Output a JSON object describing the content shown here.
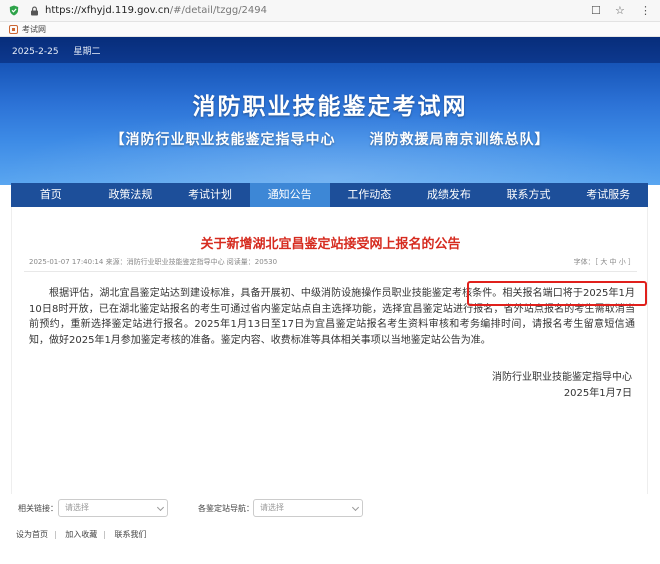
{
  "browser": {
    "url_main": "https://xfhyjd.119.gov.cn",
    "url_path": "/#/detail/tzgg/2494",
    "tab_title": "考试网",
    "tools": [
      "☐",
      "☆",
      "⋮"
    ]
  },
  "banner": {
    "date": "2025-2-25",
    "weekday": "星期二",
    "title": "消防职业技能鉴定考试网",
    "subtitle_left": "【消防行业职业技能鉴定指导中心",
    "subtitle_right": "消防救援局南京训练总队】"
  },
  "nav": {
    "items": [
      {
        "label": "首页"
      },
      {
        "label": "政策法规"
      },
      {
        "label": "考试计划"
      },
      {
        "label": "通知公告",
        "active": true
      },
      {
        "label": "工作动态"
      },
      {
        "label": "成绩发布"
      },
      {
        "label": "联系方式"
      },
      {
        "label": "考试服务"
      }
    ]
  },
  "article": {
    "title": "关于新增湖北宜昌鉴定站接受网上报名的公告",
    "meta": "2025-01-07 17:40:14  来源：消防行业职业技能鉴定指导中心  阅读量：20530",
    "font_size_label": "字体：［ 大  中  小 ］",
    "body": "根据评估，湖北宜昌鉴定站达到建设标准，具备开展初、中级消防设施操作员职业技能鉴定考核条件。相关报名端口将于2025年1月10日8时开放，已在湖北鉴定站报名的考生可通过省内鉴定站点自主选择功能，选择宜昌鉴定站进行报名，省外站点报名的考生需取消当前预约，重新选择鉴定站进行报名。2025年1月13日至17日为宜昌鉴定站报名考生资料审核和考务编排时间，请报名考生留意短信通知，做好2025年1月参加鉴定考核的准备。鉴定内容、收费标准等具体相关事项以当地鉴定站公告为准。",
    "signature_org": "消防行业职业技能鉴定指导中心",
    "signature_date": "2025年1月7日"
  },
  "links": {
    "related_label": "相关链接：",
    "related_placeholder": "请选择",
    "station_label": "各鉴定站导航：",
    "station_placeholder": "请选择"
  },
  "footer": {
    "items": [
      "设为首页",
      "加入收藏",
      "联系我们"
    ]
  },
  "colors": {
    "nav_bg": "#1d4f9a",
    "nav_active": "#3d87d6",
    "title_red": "#d62b1f",
    "highlight_border": "#e0201c"
  }
}
